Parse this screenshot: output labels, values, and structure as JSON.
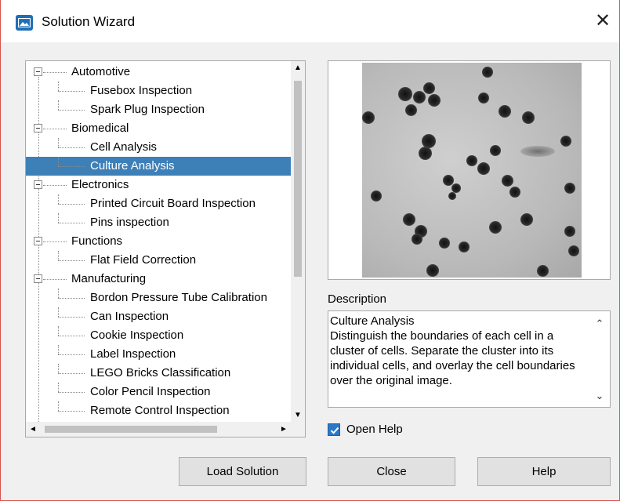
{
  "window": {
    "title": "Solution Wizard",
    "close_glyph": "✕"
  },
  "tree": {
    "items": [
      {
        "type": "category",
        "label": "Automotive"
      },
      {
        "type": "child",
        "label": "Fusebox Inspection"
      },
      {
        "type": "child",
        "label": "Spark Plug Inspection"
      },
      {
        "type": "category",
        "label": "Biomedical"
      },
      {
        "type": "child",
        "label": "Cell Analysis"
      },
      {
        "type": "child",
        "label": "Culture Analysis",
        "selected": true
      },
      {
        "type": "category",
        "label": "Electronics"
      },
      {
        "type": "child",
        "label": "Printed Circuit Board Inspection"
      },
      {
        "type": "child",
        "label": "Pins inspection"
      },
      {
        "type": "category",
        "label": "Functions"
      },
      {
        "type": "child",
        "label": "Flat Field Correction"
      },
      {
        "type": "category",
        "label": "Manufacturing"
      },
      {
        "type": "child",
        "label": "Bordon Pressure Tube Calibration"
      },
      {
        "type": "child",
        "label": "Can Inspection"
      },
      {
        "type": "child",
        "label": "Cookie Inspection"
      },
      {
        "type": "child",
        "label": "Label Inspection"
      },
      {
        "type": "child",
        "label": "LEGO Bricks Classification"
      },
      {
        "type": "child",
        "label": "Color Pencil Inspection"
      },
      {
        "type": "child",
        "label": "Remote Control Inspection"
      }
    ],
    "selected_color": "#3d80b8"
  },
  "description": {
    "label": "Description",
    "text": "Culture Analysis\nDistinguish the boundaries of each cell in a cluster of cells. Separate the cluster into its individual cells, and overlay the cell boundaries over the original image."
  },
  "open_help": {
    "label": "Open Help",
    "checked": true
  },
  "buttons": {
    "load": "Load Solution",
    "close": "Close",
    "help": "Help"
  },
  "icons": {
    "app": "image-icon",
    "scroll_up": "▲",
    "scroll_down": "▼",
    "scroll_left": "◄",
    "scroll_right": "►",
    "desc_up": "⌃",
    "desc_down": "⌄"
  }
}
